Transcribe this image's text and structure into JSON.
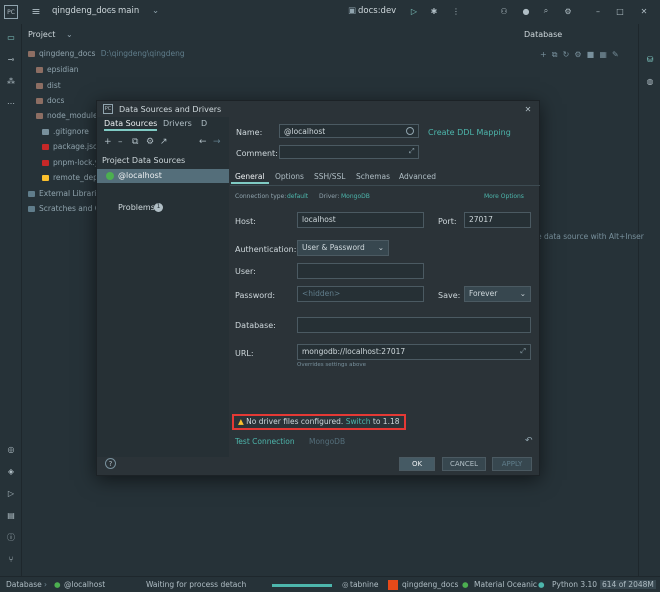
{
  "topbar": {
    "project": "qingdeng_docs",
    "branch": "main",
    "run_config": "docs:dev"
  },
  "project_panel": {
    "title": "Project",
    "root": "qingdeng_docs",
    "root_path": "D:\\qingdeng\\qingdeng",
    "items": [
      "epsidian",
      "dist",
      "docs",
      "node_modules",
      ".gitignore",
      "package.json",
      "pnpm-lock.yaml",
      "remote_deploy.sh",
      "External Libraries",
      "Scratches and Consoles"
    ]
  },
  "database_tool": {
    "title": "Database",
    "hint": "e data source with Alt+Inser"
  },
  "dialog": {
    "title": "Data Sources and Drivers",
    "left_tabs": [
      "Data Sources",
      "Drivers",
      "D"
    ],
    "section_title": "Project Data Sources",
    "selected_source": "@localhost",
    "problems_label": "Problems",
    "problems_count": "1",
    "name_label": "Name:",
    "name_value": "@localhost",
    "create_ddl": "Create DDL Mapping",
    "comment_label": "Comment:",
    "tabs": [
      "General",
      "Options",
      "SSH/SSL",
      "Schemas",
      "Advanced"
    ],
    "connection_type_label": "Connection type:",
    "connection_type_value": "default",
    "driver_label": "Driver:",
    "driver_value": "MongoDB",
    "more_options": "More Options",
    "host_label": "Host:",
    "host_value": "localhost",
    "port_label": "Port:",
    "port_value": "27017",
    "auth_label": "Authentication:",
    "auth_value": "User & Password",
    "user_label": "User:",
    "password_label": "Password:",
    "password_placeholder": "<hidden>",
    "save_label": "Save:",
    "save_value": "Forever",
    "database_label": "Database:",
    "url_label": "URL:",
    "url_value": "mongodb://localhost:27017",
    "url_hint": "Overrides settings above",
    "warning_text": "No driver files configured.",
    "warning_link": "Switch",
    "warning_suffix": "to 1.18",
    "test_connection": "Test Connection",
    "mongo_label": "MongoDB",
    "ok": "OK",
    "cancel": "CANCEL",
    "apply": "APPLY"
  },
  "statusbar": {
    "left": "Database",
    "source": "@localhost",
    "process": "Waiting for process detach",
    "tabnine": "tabnine",
    "project": "qingdeng_docs",
    "theme": "Material Oceanic",
    "python": "Python 3.10",
    "memory": "614 of 2048M"
  },
  "colors": {
    "accent": "#4db6ac",
    "warning_border": "#e53935",
    "selection": "#546e7a",
    "background": "#263238"
  }
}
